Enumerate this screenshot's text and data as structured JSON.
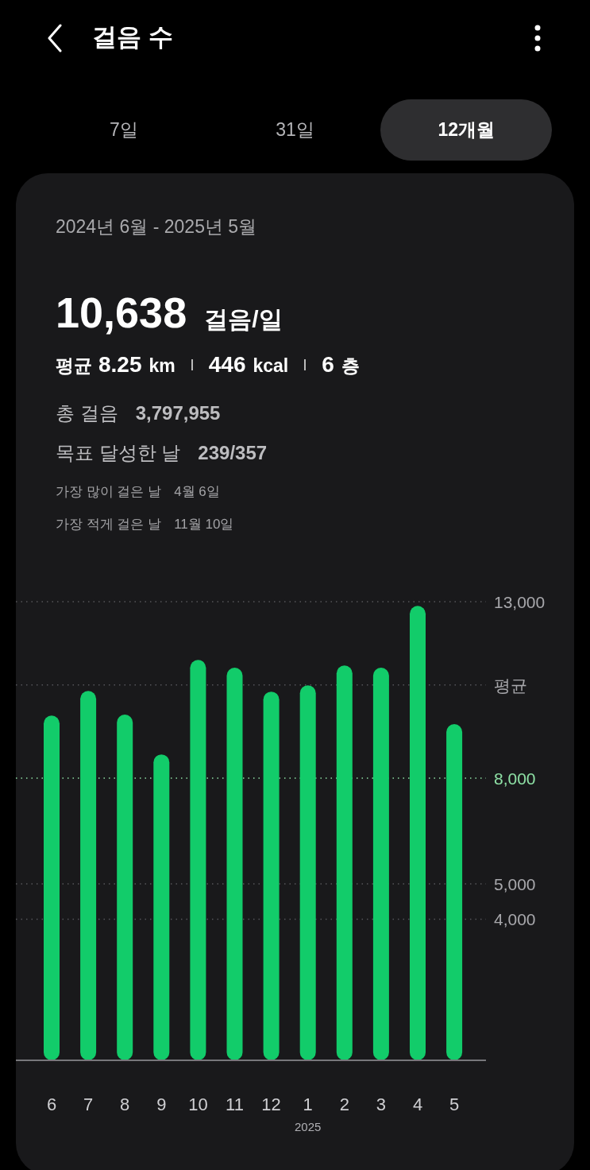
{
  "header": {
    "title": "걸음 수"
  },
  "tabs": [
    {
      "label": "7일",
      "selected": false
    },
    {
      "label": "31일",
      "selected": false
    },
    {
      "label": "12개월",
      "selected": true
    }
  ],
  "card": {
    "period": "2024년 6월 - 2025년 5월",
    "daily_steps": "10,638",
    "daily_unit": "걸음/일",
    "averages_label": "평균",
    "averages": [
      {
        "value": "8.25",
        "unit": "km"
      },
      {
        "value": "446",
        "unit": "kcal"
      },
      {
        "value": "6",
        "unit": "층"
      }
    ],
    "stats": [
      {
        "label": "총 걸음",
        "value": "3,797,955"
      },
      {
        "label": "목표 달성한 날",
        "value": "239/357"
      }
    ],
    "records": [
      {
        "label": "가장 많이 걸은 날",
        "value": "4월 6일"
      },
      {
        "label": "가장 적게 걸은 날",
        "value": "11월 10일"
      }
    ],
    "chart_data": {
      "type": "bar",
      "categories": [
        "6",
        "7",
        "8",
        "9",
        "10",
        "11",
        "12",
        "1",
        "2",
        "3",
        "4",
        "5"
      ],
      "series": [
        {
          "color": "#12cc6a",
          "values": [
            9770,
            10470,
            9800,
            8670,
            11350,
            11130,
            10450,
            10630,
            11190,
            11130,
            12880,
            9530
          ]
        }
      ],
      "ylim": [
        0,
        13000
      ],
      "yticks": [
        {
          "value": 4000,
          "label": "4,000"
        },
        {
          "value": 5000,
          "label": "5,000"
        },
        {
          "value": 8000,
          "label": "8,000"
        },
        {
          "value": 10638,
          "label": "평균"
        },
        {
          "value": 13000,
          "label": "13,000"
        }
      ],
      "grid": true,
      "ref_lines": [
        {
          "axis": "y",
          "value": 8000,
          "color": "#8ee0a5"
        }
      ],
      "annotations": [
        "2025"
      ]
    }
  }
}
